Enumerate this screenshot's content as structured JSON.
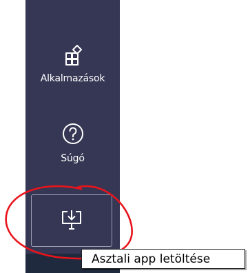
{
  "sidebar": {
    "items": [
      {
        "label": "Alkalmazások",
        "icon": "apps-grid-icon"
      },
      {
        "label": "Súgó",
        "icon": "help-circle-icon"
      }
    ],
    "download_button": {
      "icon": "download-desktop-icon"
    }
  },
  "tooltip": {
    "text": "Asztali app letöltése"
  },
  "colors": {
    "rail_background": "#353754",
    "rail_bottom": "#1f2a3e",
    "annotation": "#e8141c",
    "icon": "#ffffff"
  }
}
